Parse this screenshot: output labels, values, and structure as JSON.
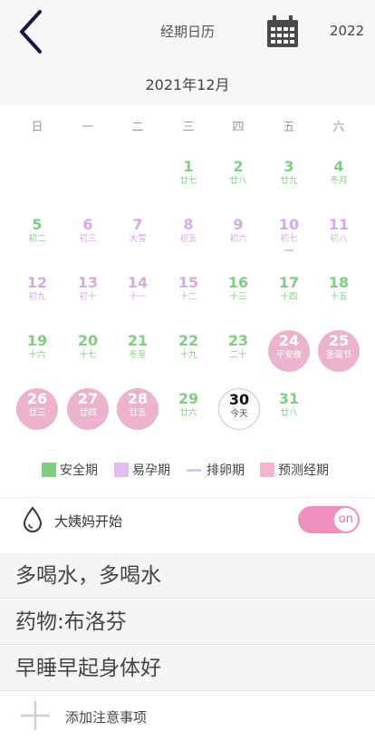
{
  "header": {
    "back_icon": "chevron-left-icon",
    "title": "经期日历",
    "calendar_icon": "calendar-icon",
    "year": "2022"
  },
  "month_label": "2021年12月",
  "weekdays": [
    "日",
    "一",
    "二",
    "三",
    "四",
    "五",
    "六"
  ],
  "days": [
    {
      "num": "1",
      "sub": "廿七",
      "type": "safe"
    },
    {
      "num": "2",
      "sub": "廿八",
      "type": "safe"
    },
    {
      "num": "3",
      "sub": "廿九",
      "type": "safe"
    },
    {
      "num": "4",
      "sub": "冬月",
      "type": "safe"
    },
    {
      "num": "5",
      "sub": "初二",
      "type": "safe"
    },
    {
      "num": "6",
      "sub": "初三",
      "type": "fertile"
    },
    {
      "num": "7",
      "sub": "大雪",
      "type": "fertile"
    },
    {
      "num": "8",
      "sub": "初五",
      "type": "fertile"
    },
    {
      "num": "9",
      "sub": "初六",
      "type": "fertile"
    },
    {
      "num": "10",
      "sub": "初七",
      "type": "ovulation"
    },
    {
      "num": "11",
      "sub": "初八",
      "type": "fertile"
    },
    {
      "num": "12",
      "sub": "初九",
      "type": "fertile"
    },
    {
      "num": "13",
      "sub": "初十",
      "type": "fertile"
    },
    {
      "num": "14",
      "sub": "十一",
      "type": "fertile"
    },
    {
      "num": "15",
      "sub": "十二",
      "type": "fertile"
    },
    {
      "num": "16",
      "sub": "十三",
      "type": "safe"
    },
    {
      "num": "17",
      "sub": "十四",
      "type": "safe"
    },
    {
      "num": "18",
      "sub": "十五",
      "type": "safe"
    },
    {
      "num": "19",
      "sub": "十六",
      "type": "safe"
    },
    {
      "num": "20",
      "sub": "十七",
      "type": "safe"
    },
    {
      "num": "21",
      "sub": "冬至",
      "type": "safe"
    },
    {
      "num": "22",
      "sub": "十九",
      "type": "safe"
    },
    {
      "num": "23",
      "sub": "二十",
      "type": "safe"
    },
    {
      "num": "24",
      "sub": "平安夜",
      "type": "period"
    },
    {
      "num": "25",
      "sub": "圣诞节",
      "type": "period"
    },
    {
      "num": "26",
      "sub": "廿三",
      "type": "period"
    },
    {
      "num": "27",
      "sub": "廿四",
      "type": "period"
    },
    {
      "num": "28",
      "sub": "廿五",
      "type": "period"
    },
    {
      "num": "29",
      "sub": "廿六",
      "type": "safe"
    },
    {
      "num": "30",
      "sub": "今天",
      "type": "today"
    },
    {
      "num": "31",
      "sub": "廿八",
      "type": "safe"
    }
  ],
  "legend": {
    "safe": "安全期",
    "fertile": "易孕期",
    "ovulation": "排卵期",
    "predicted": "预测经期"
  },
  "colors": {
    "safe": "#7fcf7f",
    "fertile": "#d8a8e8",
    "ovulation": "#d8c8ee",
    "period": "#ecb3cf",
    "toggle": "#ef8fbd"
  },
  "period_start": {
    "icon": "water-drop-icon",
    "label": "大姨妈开始",
    "toggle_state": "on"
  },
  "notes": [
    "多喝水，多喝水",
    "药物:布洛芬",
    "早睡早起身体好"
  ],
  "add_note": {
    "icon": "plus-icon",
    "label": "添加注意事项"
  }
}
